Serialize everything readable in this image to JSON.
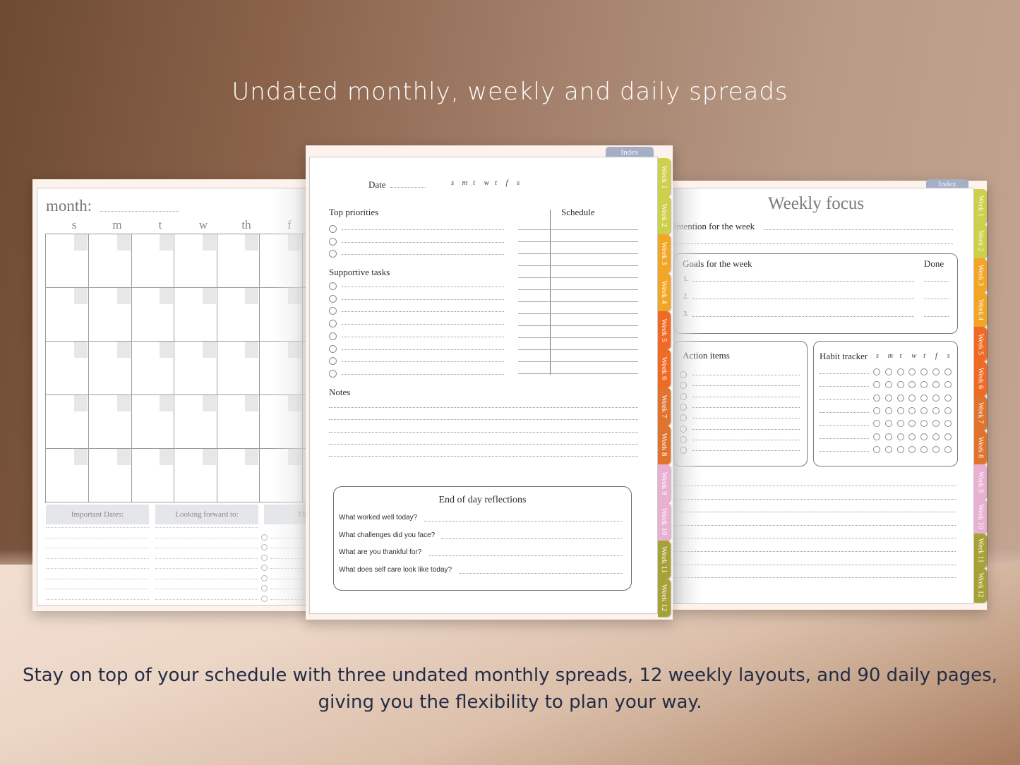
{
  "headline": "Undated monthly, weekly and daily spreads",
  "caption_line1": "Stay on top of your schedule with three undated monthly spreads, 12 weekly layouts, and 90 daily pages,",
  "caption_line2": "giving you the flexibility to plan your way.",
  "colors": {
    "index_tab": "#a5b0c6",
    "week_tabs": [
      "#cdd04a",
      "#cdd04a",
      "#f2a626",
      "#f2a626",
      "#ef6a25",
      "#ef6a25",
      "#e0742e",
      "#e0742e",
      "#e8b1d2",
      "#e8b1d2",
      "#a6a237",
      "#a6a237"
    ],
    "caption_text": "#232c45"
  },
  "monthly": {
    "title": "month:",
    "days": [
      "s",
      "m",
      "t",
      "w",
      "th",
      "f"
    ],
    "boxes": [
      "Important Dates:",
      "Looking forward to:",
      "Things"
    ]
  },
  "daily": {
    "index_label": "Index",
    "date_label": "Date",
    "weekdays": [
      "s",
      "m",
      "t",
      "w",
      "t",
      "f",
      "s"
    ],
    "top_priorities": "Top priorities",
    "schedule": "Schedule",
    "supportive_tasks": "Supportive tasks",
    "notes": "Notes",
    "reflections_title": "End of day reflections",
    "reflections": [
      "What worked well today?",
      "What challenges did you face?",
      "What are you thankful for?",
      "What does self care look like today?"
    ]
  },
  "weekly": {
    "index_label": "Index",
    "title": "Weekly focus",
    "intention": "Intention for the week",
    "goals_title": "Goals for the week",
    "done": "Done",
    "goal_numbers": [
      "1.",
      "2.",
      "3."
    ],
    "action_items": "Action items",
    "habit_tracker": "Habit tracker",
    "weekdays": [
      "s",
      "m",
      "t",
      "w",
      "t",
      "f",
      "s"
    ]
  },
  "week_tabs": [
    "Week 1",
    "Week 2",
    "Week 3",
    "Week 4",
    "Week 5",
    "Week 6",
    "Week 7",
    "Week 8",
    "Week 9",
    "Week 10",
    "Week 11",
    "Week 12"
  ]
}
